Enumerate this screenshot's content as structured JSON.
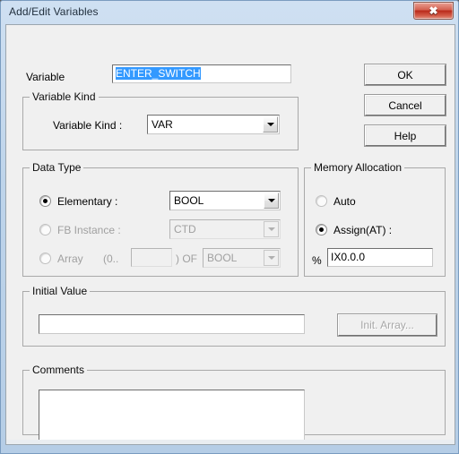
{
  "window": {
    "title": "Add/Edit Variables",
    "close_label": "✖"
  },
  "variable_row": {
    "label": "Variable",
    "value": "ENTER_SWITCH",
    "placeholder": ""
  },
  "buttons": {
    "ok": "OK",
    "cancel": "Cancel",
    "help": "Help"
  },
  "variable_kind": {
    "group_title": "Variable Kind",
    "field_label": "Variable Kind :",
    "selected": "VAR"
  },
  "data_type": {
    "group_title": "Data Type",
    "elementary": {
      "label": "Elementary :",
      "selected": true,
      "value": "BOOL"
    },
    "fb_instance": {
      "label": "FB Instance :",
      "selected": false,
      "value": "CTD"
    },
    "array": {
      "label": "Array",
      "selected": false,
      "range_prefix": "(0..",
      "range_value": "",
      "range_suffix": ") OF",
      "value": "BOOL"
    }
  },
  "memory_allocation": {
    "group_title": "Memory Allocation",
    "auto": {
      "label": "Auto",
      "selected": false
    },
    "assign": {
      "label": "Assign(AT) :",
      "selected": true,
      "percent_sign": "%",
      "value": "IX0.0.0"
    }
  },
  "initial_value": {
    "group_title": "Initial Value",
    "value": "",
    "init_array_button": "Init. Array..."
  },
  "comments": {
    "group_title": "Comments",
    "value": ""
  },
  "colors": {
    "titlebar_top": "#cfe0f2",
    "titlebar_bottom": "#b5cde6",
    "client_bg": "#f0f0f0",
    "selection_blue": "#3399ff",
    "close_red": "#b8291a"
  }
}
